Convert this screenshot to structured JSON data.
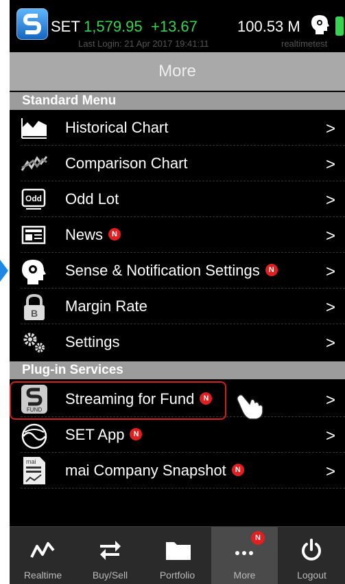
{
  "status": {
    "market": "SET",
    "index_value": "1,579.95",
    "index_change": "+13.67",
    "volume": "100.53 M",
    "last_login": "Last Login: 21 Apr 2017 19:41:11",
    "user": "realtimetest",
    "up_color": "#39d353"
  },
  "header": {
    "title": "More"
  },
  "sections": {
    "standard": "Standard Menu",
    "plugin": "Plug-in Services"
  },
  "standard_items": [
    {
      "label": "Historical Chart",
      "icon": "area-chart-icon"
    },
    {
      "label": "Comparison Chart",
      "icon": "compare-chart-icon"
    },
    {
      "label": "Odd Lot",
      "icon": "odd-lot-icon",
      "icon_text": "Odd"
    },
    {
      "label": "News",
      "icon": "newspaper-icon",
      "badge": "N"
    },
    {
      "label": "Sense & Notification Settings",
      "icon": "sense-head-icon",
      "badge": "N"
    },
    {
      "label": "Margin Rate",
      "icon": "lock-icon",
      "icon_text": "B"
    },
    {
      "label": "Settings",
      "icon": "gears-icon"
    }
  ],
  "plugin_items": [
    {
      "label": "Streaming for Fund",
      "icon": "streaming-fund-icon",
      "icon_text": "FUND",
      "badge": "N"
    },
    {
      "label": "SET App",
      "icon": "set-app-icon",
      "badge": "N"
    },
    {
      "label": "mai Company Snapshot",
      "icon": "mai-snapshot-icon",
      "icon_text": "mai",
      "badge": "N"
    }
  ],
  "chevron": ">",
  "tabs": [
    {
      "label": "Realtime",
      "icon": "pulse-line-icon"
    },
    {
      "label": "Buy/Sell",
      "icon": "swap-arrows-icon"
    },
    {
      "label": "Portfolio",
      "icon": "folder-icon"
    },
    {
      "label": "More",
      "icon": "more-dots-icon",
      "badge": "N",
      "active": true
    },
    {
      "label": "Logout",
      "icon": "power-icon"
    }
  ],
  "accent_colors": {
    "badge": "#e02020",
    "highlight": "#d32020",
    "pointer_arrow": "#1e88e5"
  }
}
